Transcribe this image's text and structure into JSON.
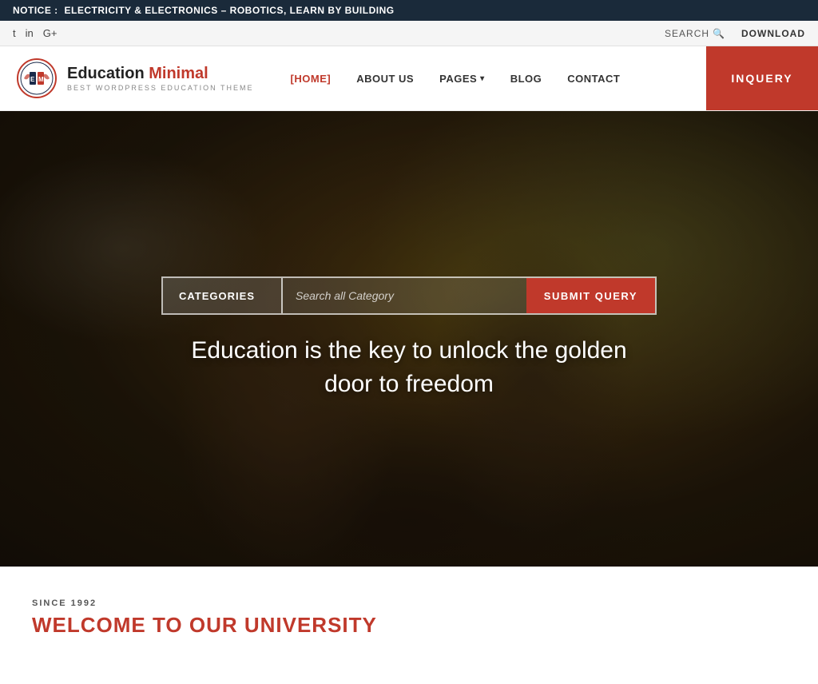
{
  "notice": {
    "label": "NOTICE :",
    "text": "ELECTRICITY & ELECTRONICS – ROBOTICS, LEARN BY BUILDING"
  },
  "topbar": {
    "social": [
      {
        "name": "twitter",
        "icon": "𝕏",
        "label": "t"
      },
      {
        "name": "linkedin",
        "icon": "in",
        "label": "in"
      },
      {
        "name": "google-plus",
        "icon": "G+",
        "label": "G+"
      }
    ],
    "search_label": "SEARCH",
    "download_label": "DOWNLOAD"
  },
  "header": {
    "logo": {
      "initials": "EM",
      "site_name_part1": "Education ",
      "site_name_part2": "Minimal",
      "tagline": "BEST WORDPRESS EDUCATION THEME"
    },
    "nav": [
      {
        "label": "HOME",
        "active": true
      },
      {
        "label": "ABOUT US",
        "active": false
      },
      {
        "label": "PAGES",
        "active": false,
        "has_dropdown": true
      },
      {
        "label": "BLOG",
        "active": false
      },
      {
        "label": "CONTACT",
        "active": false
      }
    ],
    "inquiry_label": "INQUERY"
  },
  "hero": {
    "search": {
      "categories_label": "CATEGORIES",
      "placeholder": "Search all Category",
      "submit_label": "SUBMIT QUERY"
    },
    "tagline": "Education is the key to unlock the golden door to freedom"
  },
  "below_hero": {
    "since_label": "SINCE 1992",
    "welcome_heading": "WELCOME TO OUR UNIVERSITY"
  }
}
